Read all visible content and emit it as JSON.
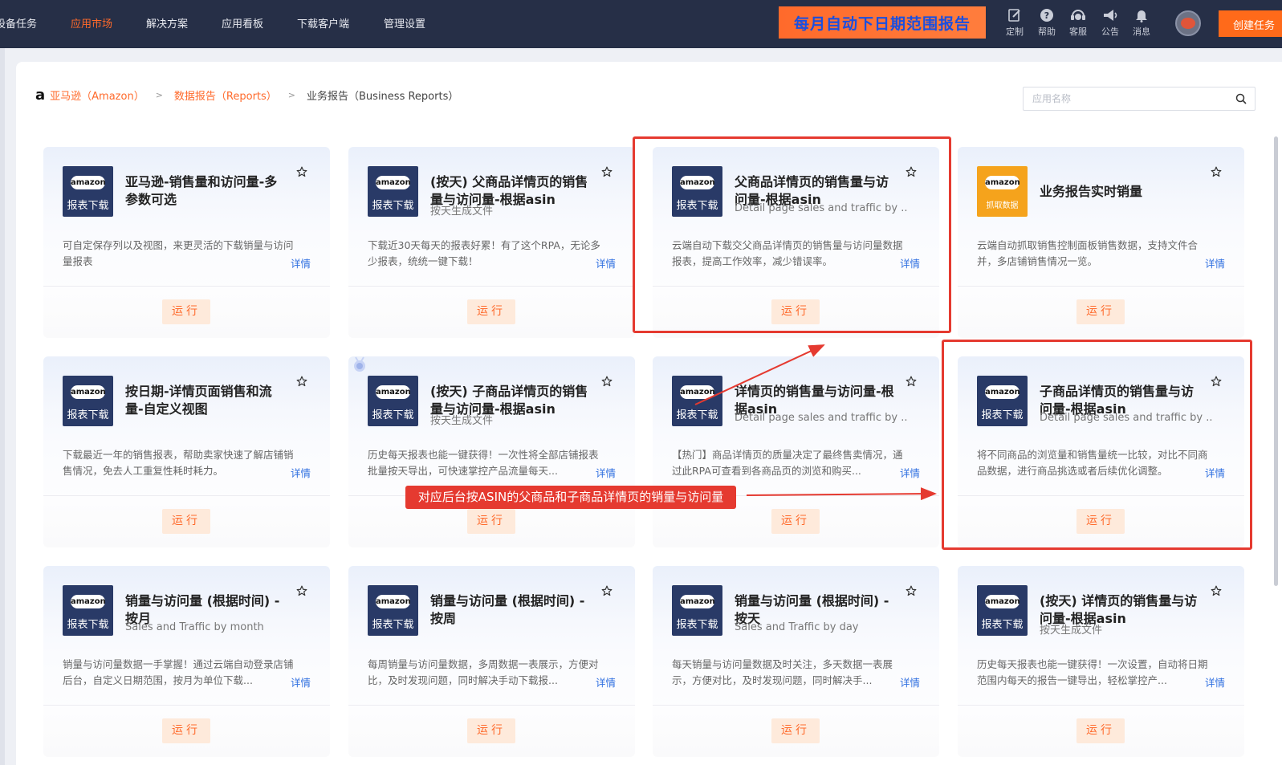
{
  "nav": {
    "items": [
      "设备任务",
      "应用市场",
      "解决方案",
      "应用看板",
      "下载客户端",
      "管理设置"
    ],
    "active": "应用市场",
    "banner": "每月自动下日期范围报告",
    "tools": [
      "定制",
      "帮助",
      "客服",
      "公告",
      "消息"
    ],
    "create_label": "创建任务"
  },
  "breadcrumb": {
    "items": [
      "亚马逊（Amazon）",
      "数据报告（Reports）",
      "业务报告（Business Reports）"
    ]
  },
  "search": {
    "placeholder": "应用名称"
  },
  "cards": [
    {
      "logo": "amazon",
      "tag": "报表下载",
      "title": "亚马逊-销售量和访问量-多参数可选",
      "subtitle": "",
      "desc": "可自定保存列以及视图，来更灵活的下载销量与访问量报表",
      "more": "详情",
      "run": "运行"
    },
    {
      "logo": "amazon",
      "tag": "报表下载",
      "title": "(按天) 父商品详情页的销售量与访问量-根据asin",
      "subtitle": "按天生成文件",
      "desc": "下载近30天每天的报表好累！有了这个RPA，无论多少报表，统统一键下载！",
      "more": "详情",
      "run": "运行"
    },
    {
      "logo": "amazon",
      "tag": "报表下载",
      "title": "父商品详情页的销售量与访问量-根据asin",
      "subtitle": "Detail page sales and traffic by ...",
      "desc": "云端自动下载交父商品详情页的销售量与访问量数据报表，提高工作效率，减少错误率。",
      "more": "详情",
      "run": "运行"
    },
    {
      "logo": "amazon",
      "tag": "抓取数据",
      "title": "业务报告实时销量",
      "subtitle": "",
      "desc": "云端自动抓取销售控制面板销售数据，支持文件合并，多店铺销售情况一览。",
      "more": "详情",
      "run": "运行"
    },
    {
      "logo": "amazon",
      "tag": "报表下载",
      "title": "按日期-详情页面销售和流量-自定义视图",
      "subtitle": "",
      "desc": "下载最近一年的销售报表，帮助卖家快速了解店铺销售情况，免去人工重复性耗时耗力。",
      "more": "详情",
      "run": "运行"
    },
    {
      "logo": "amazon",
      "tag": "报表下载",
      "title": "(按天) 子商品详情页的销售量与访问量-根据asin",
      "subtitle": "按天生成文件",
      "desc": "历史每天报表也能一键获得！一次性将全部店铺报表批量按天导出，可快速掌控产品流量每天...",
      "more": "详情",
      "run": "运行"
    },
    {
      "logo": "amazon",
      "tag": "报表下载",
      "title": "详情页的销售量与访问量-根据asin",
      "subtitle": "Detail page sales and traffic by ...",
      "desc": "【热门】商品详情页的质量决定了最终售卖情况，通过此RPA可查看到各商品页的浏览和购买...",
      "more": "详情",
      "run": "运行"
    },
    {
      "logo": "amazon",
      "tag": "报表下载",
      "title": "子商品详情页的销售量与访问量-根据asin",
      "subtitle": "Detail page sales and traffic by ...",
      "desc": "将不同商品的浏览量和销售量统一比较，对比不同商品数据，进行商品挑选或者后续优化调整。",
      "more": "详情",
      "run": "运行"
    },
    {
      "logo": "amazon",
      "tag": "报表下载",
      "title": "销量与访问量 (根据时间) -按月",
      "subtitle": "Sales and Traffic by month",
      "desc": "销量与访问量数据一手掌握！通过云端自动登录店铺后台，自定义日期范围，按月为单位下载...",
      "more": "详情",
      "run": "运行"
    },
    {
      "logo": "amazon",
      "tag": "报表下载",
      "title": "销量与访问量 (根据时间) -按周",
      "subtitle": "",
      "desc": "每周销量与访问量数据，多周数据一表展示，方便对比，及时发现问题，同时解决手动下载报...",
      "more": "详情",
      "run": "运行"
    },
    {
      "logo": "amazon",
      "tag": "报表下载",
      "title": "销量与访问量 (根据时间) -按天",
      "subtitle": "Sales and Traffic by day",
      "desc": "每天销量与访问量数据及时关注，多天数据一表展示，方便对比，及时发现问题，同时解决手...",
      "more": "详情",
      "run": "运行"
    },
    {
      "logo": "amazon",
      "tag": "报表下载",
      "title": "(按天) 详情页的销售量与访问量-根据asin",
      "subtitle": "按天生成文件",
      "desc": "历史每天报表也能一键获得！一次设置，自动将日期范围内每天的报告一键导出，轻松掌控产...",
      "more": "详情",
      "run": "运行"
    }
  ],
  "annotation": {
    "callout": "对应后台按ASIN的父商品和子商品详情页的销量与访问量"
  },
  "colors": {
    "accent": "#ff6a2b",
    "nav_bg": "#262f47",
    "annotation": "#e53a30",
    "link": "#2f6fe0"
  }
}
